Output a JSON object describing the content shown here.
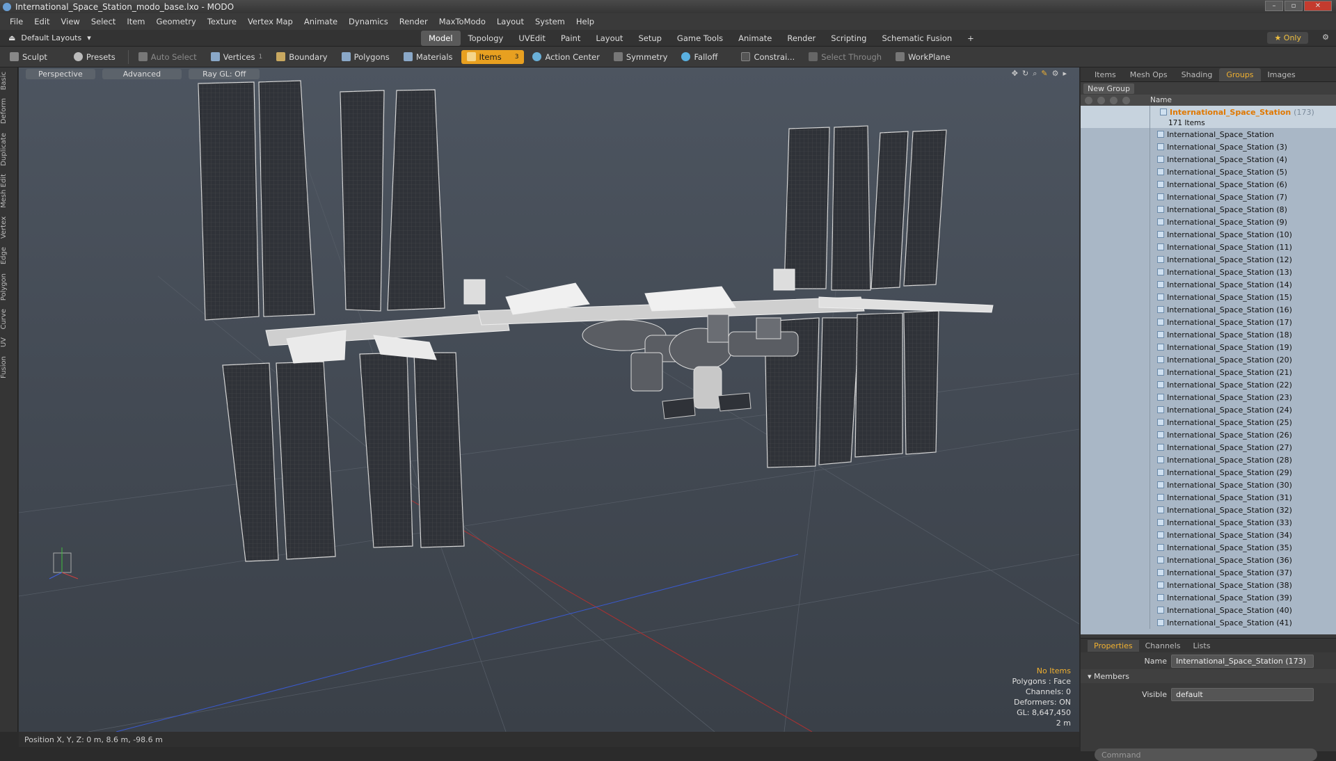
{
  "window": {
    "title": "International_Space_Station_modo_base.lxo - MODO"
  },
  "menu": [
    "File",
    "Edit",
    "View",
    "Select",
    "Item",
    "Geometry",
    "Texture",
    "Vertex Map",
    "Animate",
    "Dynamics",
    "Render",
    "MaxToModo",
    "Layout",
    "System",
    "Help"
  ],
  "layout": {
    "dropdown": "Default Layouts",
    "only_label": "Only"
  },
  "layout_tabs": [
    {
      "label": "Model",
      "active": true
    },
    {
      "label": "Topology"
    },
    {
      "label": "UVEdit"
    },
    {
      "label": "Paint"
    },
    {
      "label": "Layout"
    },
    {
      "label": "Setup"
    },
    {
      "label": "Game Tools"
    },
    {
      "label": "Animate"
    },
    {
      "label": "Render"
    },
    {
      "label": "Scripting"
    },
    {
      "label": "Schematic Fusion"
    }
  ],
  "toolbar": {
    "sculpt": "Sculpt",
    "presets": "Presets",
    "auto_select": "Auto Select",
    "vertices": "Vertices",
    "vertices_count": "1",
    "boundary": "Boundary",
    "polygons": "Polygons",
    "materials": "Materials",
    "items": "Items",
    "items_count": "3",
    "action_center": "Action Center",
    "symmetry": "Symmetry",
    "falloff": "Falloff",
    "constraints": "Constrai...",
    "select_through": "Select Through",
    "workplane": "WorkPlane"
  },
  "left_tabs": [
    "Basic",
    "Deform",
    "Duplicate",
    "Mesh Edit",
    "Vertex",
    "Edge",
    "Polygon",
    "Curve",
    "UV",
    "Fusion"
  ],
  "viewport": {
    "view": "Perspective",
    "shading": "Advanced",
    "raygl": "Ray GL: Off",
    "hud": {
      "selection": "No Items",
      "polygons": "Polygons : Face",
      "channels": "Channels: 0",
      "deformers": "Deformers: ON",
      "gl": "GL: 8,647,450",
      "scale": "2 m"
    }
  },
  "status": {
    "position": "Position X, Y, Z:  0 m, 8.6 m, -98.6 m"
  },
  "right_tabs": [
    {
      "label": "Items"
    },
    {
      "label": "Mesh Ops"
    },
    {
      "label": "Shading"
    },
    {
      "label": "Groups",
      "active": true
    },
    {
      "label": "Images"
    }
  ],
  "groups": {
    "new_group": "New Group",
    "col_name": "Name",
    "root_name": "International_Space_Station",
    "root_count": "(173)",
    "sub_label": "171 Items",
    "items": [
      "International_Space_Station",
      "International_Space_Station (3)",
      "International_Space_Station (4)",
      "International_Space_Station (5)",
      "International_Space_Station (6)",
      "International_Space_Station (7)",
      "International_Space_Station (8)",
      "International_Space_Station (9)",
      "International_Space_Station (10)",
      "International_Space_Station (11)",
      "International_Space_Station (12)",
      "International_Space_Station (13)",
      "International_Space_Station (14)",
      "International_Space_Station (15)",
      "International_Space_Station (16)",
      "International_Space_Station (17)",
      "International_Space_Station (18)",
      "International_Space_Station (19)",
      "International_Space_Station (20)",
      "International_Space_Station (21)",
      "International_Space_Station (22)",
      "International_Space_Station (23)",
      "International_Space_Station (24)",
      "International_Space_Station (25)",
      "International_Space_Station (26)",
      "International_Space_Station (27)",
      "International_Space_Station (28)",
      "International_Space_Station (29)",
      "International_Space_Station (30)",
      "International_Space_Station (31)",
      "International_Space_Station (32)",
      "International_Space_Station (33)",
      "International_Space_Station (34)",
      "International_Space_Station (35)",
      "International_Space_Station (36)",
      "International_Space_Station (37)",
      "International_Space_Station (38)",
      "International_Space_Station (39)",
      "International_Space_Station (40)",
      "International_Space_Station (41)"
    ]
  },
  "properties": {
    "tabs": [
      {
        "label": "Properties",
        "active": true
      },
      {
        "label": "Channels"
      },
      {
        "label": "Lists"
      }
    ],
    "name_label": "Name",
    "name_value": "International_Space_Station (173)",
    "members": "Members",
    "visible_label": "Visible",
    "visible_value": "default",
    "command_placeholder": "Command"
  }
}
